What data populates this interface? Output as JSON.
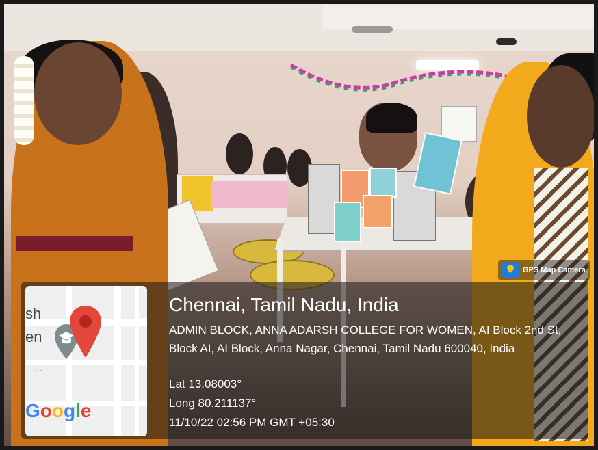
{
  "watermark": {
    "app_name": "GPS Map Camera",
    "app_icon": "gps-map-camera-icon"
  },
  "map_thumbnail": {
    "street_fragment_1": "sh",
    "street_fragment_2": "en",
    "ellipsis": "...",
    "pin_icon": "location-pin-icon",
    "education_icon": "graduation-cap-icon",
    "brand": {
      "G": "G",
      "o1": "o",
      "o2": "o",
      "g": "g",
      "l": "l",
      "e": "e"
    }
  },
  "location": {
    "title": "Chennai, Tamil Nadu, India",
    "address": "ADMIN BLOCK, ANNA ADARSH COLLEGE FOR WOMEN, AI Block 2nd St, Block AI, AI Block, Anna Nagar, Chennai, Tamil Nadu 600040, India",
    "lat": "Lat 13.08003°",
    "long": "Long 80.211137°",
    "timestamp": "11/10/22 02:56 PM GMT +05:30"
  },
  "colors": {
    "overlay": "#141414",
    "pin": "#e3463a",
    "saree": "#c8731c",
    "kurta": "#f2a91c"
  }
}
